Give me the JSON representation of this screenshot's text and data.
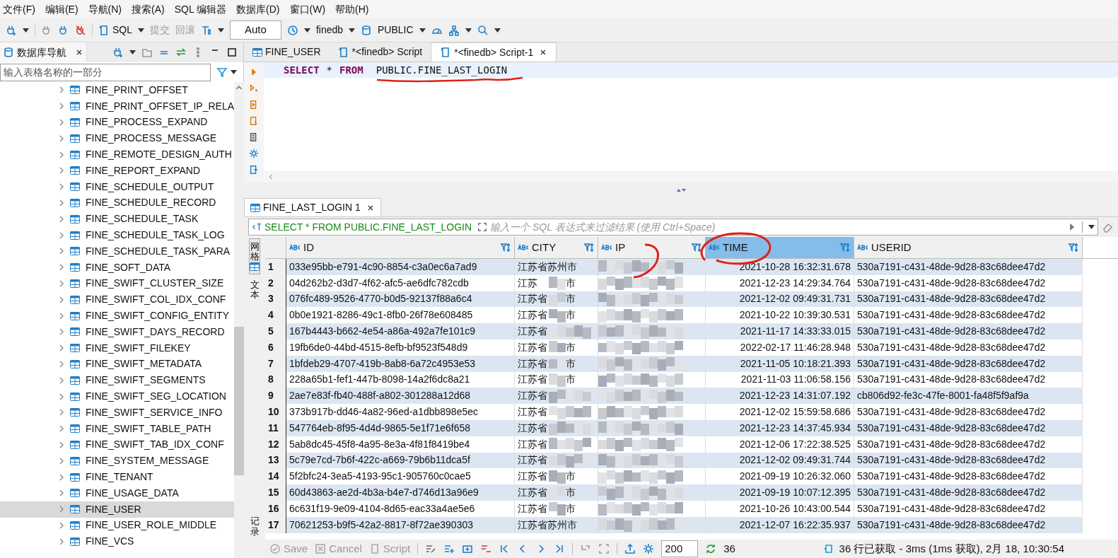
{
  "menu": [
    "文件(F)",
    "编辑(E)",
    "导航(N)",
    "搜索(A)",
    "SQL 编辑器",
    "数据库(D)",
    "窗口(W)",
    "帮助(H)"
  ],
  "toolbar": {
    "sql": "SQL",
    "commit": "提交",
    "rollback": "回滚",
    "mode": "Auto",
    "database": "finedb",
    "schema": "PUBLIC"
  },
  "navigator": {
    "title": "数据库导航",
    "filter_placeholder": "输入表格名称的一部分",
    "items": [
      {
        "name": "FINE_PRINT_OFFSET",
        "selected": false
      },
      {
        "name": "FINE_PRINT_OFFSET_IP_RELA",
        "selected": false
      },
      {
        "name": "FINE_PROCESS_EXPAND",
        "selected": false
      },
      {
        "name": "FINE_PROCESS_MESSAGE",
        "selected": false
      },
      {
        "name": "FINE_REMOTE_DESIGN_AUTH",
        "selected": false
      },
      {
        "name": "FINE_REPORT_EXPAND",
        "selected": false
      },
      {
        "name": "FINE_SCHEDULE_OUTPUT",
        "selected": false
      },
      {
        "name": "FINE_SCHEDULE_RECORD",
        "selected": false
      },
      {
        "name": "FINE_SCHEDULE_TASK",
        "selected": false
      },
      {
        "name": "FINE_SCHEDULE_TASK_LOG",
        "selected": false
      },
      {
        "name": "FINE_SCHEDULE_TASK_PARA",
        "selected": false
      },
      {
        "name": "FINE_SOFT_DATA",
        "selected": false
      },
      {
        "name": "FINE_SWIFT_CLUSTER_SIZE",
        "selected": false
      },
      {
        "name": "FINE_SWIFT_COL_IDX_CONF",
        "selected": false
      },
      {
        "name": "FINE_SWIFT_CONFIG_ENTITY",
        "selected": false
      },
      {
        "name": "FINE_SWIFT_DAYS_RECORD",
        "selected": false
      },
      {
        "name": "FINE_SWIFT_FILEKEY",
        "selected": false
      },
      {
        "name": "FINE_SWIFT_METADATA",
        "selected": false
      },
      {
        "name": "FINE_SWIFT_SEGMENTS",
        "selected": false
      },
      {
        "name": "FINE_SWIFT_SEG_LOCATION",
        "selected": false
      },
      {
        "name": "FINE_SWIFT_SERVICE_INFO",
        "selected": false
      },
      {
        "name": "FINE_SWIFT_TABLE_PATH",
        "selected": false
      },
      {
        "name": "FINE_SWIFT_TAB_IDX_CONF",
        "selected": false
      },
      {
        "name": "FINE_SYSTEM_MESSAGE",
        "selected": false
      },
      {
        "name": "FINE_TENANT",
        "selected": false
      },
      {
        "name": "FINE_USAGE_DATA",
        "selected": false
      },
      {
        "name": "FINE_USER",
        "selected": true
      },
      {
        "name": "FINE_USER_ROLE_MIDDLE",
        "selected": false
      },
      {
        "name": "FINE_VCS",
        "selected": false
      }
    ]
  },
  "editor_tabs": [
    {
      "label": "FINE_USER",
      "kind": "table",
      "selected": false
    },
    {
      "label": "*<finedb> Script",
      "kind": "script",
      "selected": false
    },
    {
      "label": "*<finedb> Script-1",
      "kind": "script",
      "selected": true
    }
  ],
  "query": {
    "keyword1": "SELECT",
    "star": "*",
    "keyword2": "FROM",
    "table": "PUBLIC.FINE_LAST_LOGIN"
  },
  "results": {
    "tab": "FINE_LAST_LOGIN 1",
    "query": "SELECT * FROM PUBLIC.FINE_LAST_LOGIN",
    "filter_placeholder": "输入一个 SQL 表达式来过滤结果 (使用 Ctrl+Space)",
    "side_tabs": [
      "网格",
      "文本",
      "记录"
    ],
    "columns": [
      {
        "label": "ID",
        "selected": false
      },
      {
        "label": "CITY",
        "selected": false
      },
      {
        "label": "IP",
        "selected": false
      },
      {
        "label": "TIME",
        "selected": true
      },
      {
        "label": "USERID",
        "selected": false
      }
    ],
    "rows": [
      {
        "n": "1",
        "id": "033e95bb-e791-4c90-8854-c3a0ec6a7ad9",
        "city": "江苏省苏州市",
        "time": "2021-10-28 16:32:31.678",
        "userid": "530a7191-c431-48de-9d28-83c68dee47d2"
      },
      {
        "n": "2",
        "id": "04d262b2-d3d7-4f62-afc5-ae6dfc782cdb",
        "city": "江苏",
        "city_end": "市",
        "time": "2021-12-23 14:29:34.764",
        "userid": "530a7191-c431-48de-9d28-83c68dee47d2"
      },
      {
        "n": "3",
        "id": "076fc489-9526-4770-b0d5-92137f88a6c4",
        "city": "江苏省",
        "city_end": "市",
        "time": "2021-12-02 09:49:31.731",
        "userid": "530a7191-c431-48de-9d28-83c68dee47d2"
      },
      {
        "n": "4",
        "id": "0b0e1921-8286-49c1-8fb0-26f78e608485",
        "city": "江苏省",
        "city_end": "市",
        "time": "2021-10-22 10:39:30.531",
        "userid": "530a7191-c431-48de-9d28-83c68dee47d2"
      },
      {
        "n": "5",
        "id": "167b4443-b662-4e54-a86a-492a7fe101c9",
        "city": "江苏省",
        "time": "2021-11-17 14:33:33.015",
        "userid": "530a7191-c431-48de-9d28-83c68dee47d2"
      },
      {
        "n": "6",
        "id": "19fb6de0-44bd-4515-8efb-bf9523f548d9",
        "city": "江苏省",
        "city_end": "市",
        "time": "2022-02-17 11:46:28.948",
        "userid": "530a7191-c431-48de-9d28-83c68dee47d2"
      },
      {
        "n": "7",
        "id": "1bfdeb29-4707-419b-8ab8-6a72c4953e53",
        "city": "江苏省",
        "city_end": "市",
        "time": "2021-11-05 10:18:21.393",
        "userid": "530a7191-c431-48de-9d28-83c68dee47d2"
      },
      {
        "n": "8",
        "id": "228a65b1-fef1-447b-8098-14a2f6dc8a21",
        "city": "江苏省",
        "city_end": "市",
        "time": "2021-11-03 11:06:58.156",
        "userid": "530a7191-c431-48de-9d28-83c68dee47d2"
      },
      {
        "n": "9",
        "id": "2ae7e83f-fb40-488f-a802-301288a12d68",
        "city": "江苏省",
        "time": "2021-12-23 14:31:07.192",
        "userid": "cb806d92-fe3c-47fe-8001-fa48f5f9af9a"
      },
      {
        "n": "10",
        "id": "373b917b-dd46-4a82-96ed-a1dbb898e5ec",
        "city": "江苏省",
        "time": "2021-12-02 15:59:58.686",
        "userid": "530a7191-c431-48de-9d28-83c68dee47d2"
      },
      {
        "n": "11",
        "id": "547764eb-8f95-4d4d-9865-5e1f71e6f658",
        "city": "江苏省",
        "time": "2021-12-23 14:37:45.934",
        "userid": "530a7191-c431-48de-9d28-83c68dee47d2"
      },
      {
        "n": "12",
        "id": "5ab8dc45-45f8-4a95-8e3a-4f81f8419be4",
        "city": "江苏省",
        "time": "2021-12-06 17:22:38.525",
        "userid": "530a7191-c431-48de-9d28-83c68dee47d2"
      },
      {
        "n": "13",
        "id": "5c79e7cd-7b6f-422c-a669-79b6b11dca5f",
        "city": "江苏省",
        "time": "2021-12-02 09:49:31.744",
        "userid": "530a7191-c431-48de-9d28-83c68dee47d2"
      },
      {
        "n": "14",
        "id": "5f2bfc24-3ea5-4193-95c1-905760c0cae5",
        "city": "江苏省",
        "city_end": "市",
        "time": "2021-09-19 10:26:32.060",
        "userid": "530a7191-c431-48de-9d28-83c68dee47d2"
      },
      {
        "n": "15",
        "id": "60d43863-ae2d-4b3a-b4e7-d746d13a96e9",
        "city": "江苏省",
        "city_end": "市",
        "time": "2021-09-19 10:07:12.395",
        "userid": "530a7191-c431-48de-9d28-83c68dee47d2"
      },
      {
        "n": "16",
        "id": "6c631f19-9e09-4104-8d65-eac33a4ae5e6",
        "city": "江苏省",
        "city_end": "市",
        "time": "2021-10-26 10:43:00.544",
        "userid": "530a7191-c431-48de-9d28-83c68dee47d2"
      },
      {
        "n": "17",
        "id": "70621253-b9f5-42a2-8817-8f72ae390303",
        "city": "江苏省苏州市",
        "time": "2021-12-07 16:22:35.937",
        "userid": "530a7191-c431-48de-9d28-83c68dee47d2"
      }
    ],
    "bottom": {
      "save": "Save",
      "cancel": "Cancel",
      "script": "Script",
      "fetch_size": "200",
      "count": "36",
      "status": "36 行已获取 - 3ms (1ms 获取), 2月 18, 10:30:54"
    }
  }
}
